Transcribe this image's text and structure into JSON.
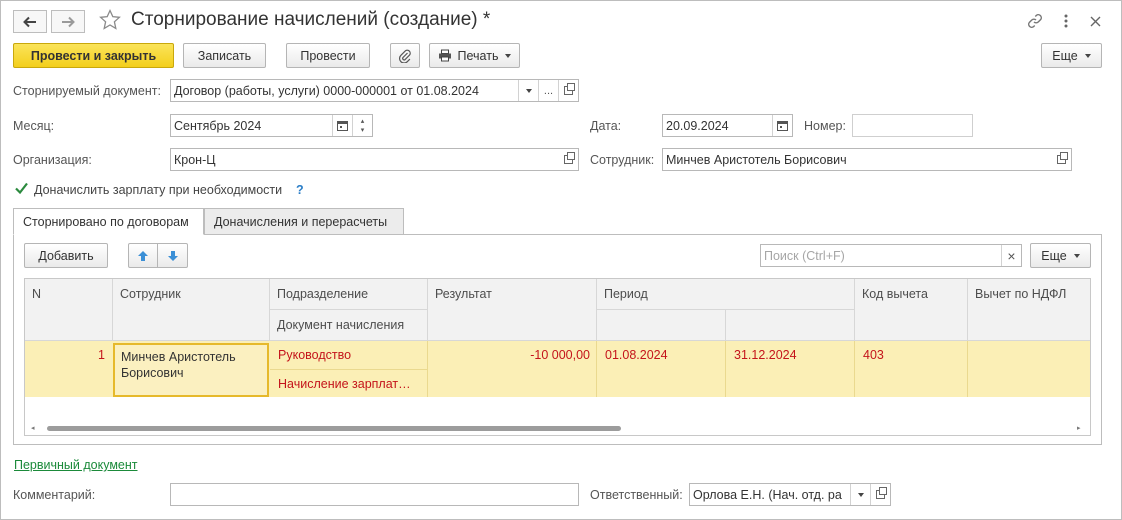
{
  "window": {
    "title": "Сторнирование начислений (создание) *",
    "back_icon": "arrow-left-icon",
    "forward_icon": "arrow-right-icon",
    "favorite_icon": "star-icon",
    "link_icon": "link-icon",
    "menu_icon": "more-vert-icon",
    "close_icon": "close-icon"
  },
  "toolbar": {
    "post_close": "Провести и закрыть",
    "save": "Записать",
    "post": "Провести",
    "attach_icon": "paperclip-icon",
    "print": "Печать",
    "more": "Еще"
  },
  "form": {
    "reversed_doc_label": "Сторнируемый документ:",
    "reversed_doc_value": "Договор (работы, услуги) 0000-000001 от 01.08.2024",
    "month_label": "Месяц:",
    "month_value": "Сентябрь 2024",
    "date_label": "Дата:",
    "date_value": "20.09.2024",
    "number_label": "Номер:",
    "number_value": "",
    "org_label": "Организация:",
    "org_value": "Крон-Ц",
    "employee_label": "Сотрудник:",
    "employee_value": "Минчев Аристотель Борисович",
    "accrue_label": "Доначислить зарплату при необходимости",
    "accrue_checked": true,
    "help": "?"
  },
  "tabs": [
    {
      "label": "Сторнировано по договорам",
      "active": true
    },
    {
      "label": "Доначисления и перерасчеты",
      "active": false
    }
  ],
  "table_toolbar": {
    "add": "Добавить",
    "up_icon": "arrow-up-icon",
    "down_icon": "arrow-down-icon",
    "search_placeholder": "Поиск (Ctrl+F)",
    "clear": "×",
    "more": "Еще"
  },
  "table": {
    "headers": {
      "n": "N",
      "employee": "Сотрудник",
      "department": "Подразделение",
      "accrual_doc": "Документ начисления",
      "result": "Результат",
      "period": "Период",
      "deduction_code": "Код вычета",
      "ndfl_deduction": "Вычет по НДФЛ"
    },
    "rows": [
      {
        "n": "1",
        "employee": "Минчев Аристотель Борисович",
        "department": "Руководство",
        "accrual_doc": "Начисление зарплат…",
        "result": "-10 000,00",
        "period_start": "01.08.2024",
        "period_end": "31.12.2024",
        "deduction_code": "403",
        "ndfl_deduction": ""
      }
    ]
  },
  "footer": {
    "primary_doc_link": "Первичный документ",
    "comment_label": "Комментарий:",
    "comment_value": "",
    "responsible_label": "Ответственный:",
    "responsible_value": "Орлова Е.Н. (Нач. отд. ра"
  },
  "colors": {
    "primary_button": "#f3cf1c",
    "selected_row": "#fbefb6",
    "red_text": "#c4141b",
    "link": "#1b8a3a",
    "arrow_blue": "#3b8fd6"
  }
}
